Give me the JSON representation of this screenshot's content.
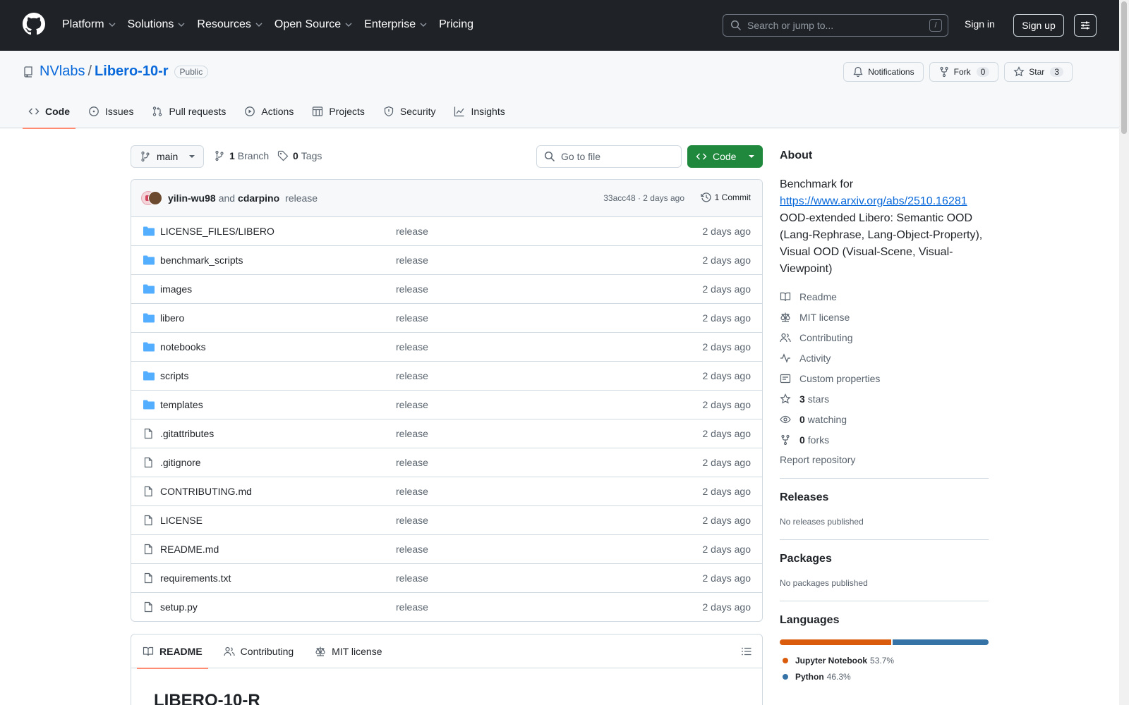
{
  "header": {
    "nav": [
      "Platform",
      "Solutions",
      "Resources",
      "Open Source",
      "Enterprise",
      "Pricing"
    ],
    "search_placeholder": "Search or jump to...",
    "search_shortcut": "/",
    "signin": "Sign in",
    "signup": "Sign up"
  },
  "repo": {
    "owner": "NVlabs",
    "separator": "/",
    "name": "Libero-10-r",
    "visibility": "Public",
    "notifications": "Notifications",
    "fork_label": "Fork",
    "fork_count": "0",
    "star_label": "Star",
    "star_count": "3",
    "tabs": [
      "Code",
      "Issues",
      "Pull requests",
      "Actions",
      "Projects",
      "Security",
      "Insights"
    ]
  },
  "toolbar": {
    "branch": "main",
    "branch_count": "1",
    "branch_label": "Branch",
    "tag_count": "0",
    "tag_label": "Tags",
    "goto_file_placeholder": "Go to file",
    "code_button": "Code"
  },
  "commit": {
    "author1": "yilin-wu98",
    "and": "and",
    "author2": "cdarpino",
    "message": "release",
    "meta": "33acc48 · 2 days ago",
    "count": "1 Commit"
  },
  "files": [
    {
      "name": "LICENSE_FILES/LIBERO",
      "type": "dir",
      "commit": "release",
      "age": "2 days ago"
    },
    {
      "name": "benchmark_scripts",
      "type": "dir",
      "commit": "release",
      "age": "2 days ago"
    },
    {
      "name": "images",
      "type": "dir",
      "commit": "release",
      "age": "2 days ago"
    },
    {
      "name": "libero",
      "type": "dir",
      "commit": "release",
      "age": "2 days ago"
    },
    {
      "name": "notebooks",
      "type": "dir",
      "commit": "release",
      "age": "2 days ago"
    },
    {
      "name": "scripts",
      "type": "dir",
      "commit": "release",
      "age": "2 days ago"
    },
    {
      "name": "templates",
      "type": "dir",
      "commit": "release",
      "age": "2 days ago"
    },
    {
      "name": ".gitattributes",
      "type": "file",
      "commit": "release",
      "age": "2 days ago"
    },
    {
      "name": ".gitignore",
      "type": "file",
      "commit": "release",
      "age": "2 days ago"
    },
    {
      "name": "CONTRIBUTING.md",
      "type": "file",
      "commit": "release",
      "age": "2 days ago"
    },
    {
      "name": "LICENSE",
      "type": "file",
      "commit": "release",
      "age": "2 days ago"
    },
    {
      "name": "README.md",
      "type": "file",
      "commit": "release",
      "age": "2 days ago"
    },
    {
      "name": "requirements.txt",
      "type": "file",
      "commit": "release",
      "age": "2 days ago"
    },
    {
      "name": "setup.py",
      "type": "file",
      "commit": "release",
      "age": "2 days ago"
    }
  ],
  "readme": {
    "tabs": [
      "README",
      "Contributing",
      "MIT license"
    ],
    "heading": "LIBERO-10-R"
  },
  "about": {
    "title": "About",
    "desc_prefix": "Benchmark for",
    "link": "https://www.arxiv.org/abs/2510.16281",
    "desc_suffix": "OOD-extended Libero: Semantic OOD (Lang-Rephrase, Lang-Object-Property), Visual OOD (Visual-Scene, Visual-Viewpoint)",
    "readme": "Readme",
    "license": "MIT license",
    "contributing": "Contributing",
    "activity": "Activity",
    "custom_properties": "Custom properties",
    "stars_count": "3",
    "stars_label": "stars",
    "watching_count": "0",
    "watching_label": "watching",
    "forks_count": "0",
    "forks_label": "forks",
    "report": "Report repository"
  },
  "releases": {
    "title": "Releases",
    "empty": "No releases published"
  },
  "packages": {
    "title": "Packages",
    "empty": "No packages published"
  },
  "languages": {
    "title": "Languages",
    "items": [
      {
        "name": "Jupyter Notebook",
        "pct": "53.7%",
        "value": 53.7,
        "color": "#DA5B0B"
      },
      {
        "name": "Python",
        "pct": "46.3%",
        "value": 46.3,
        "color": "#3572A5"
      }
    ]
  }
}
